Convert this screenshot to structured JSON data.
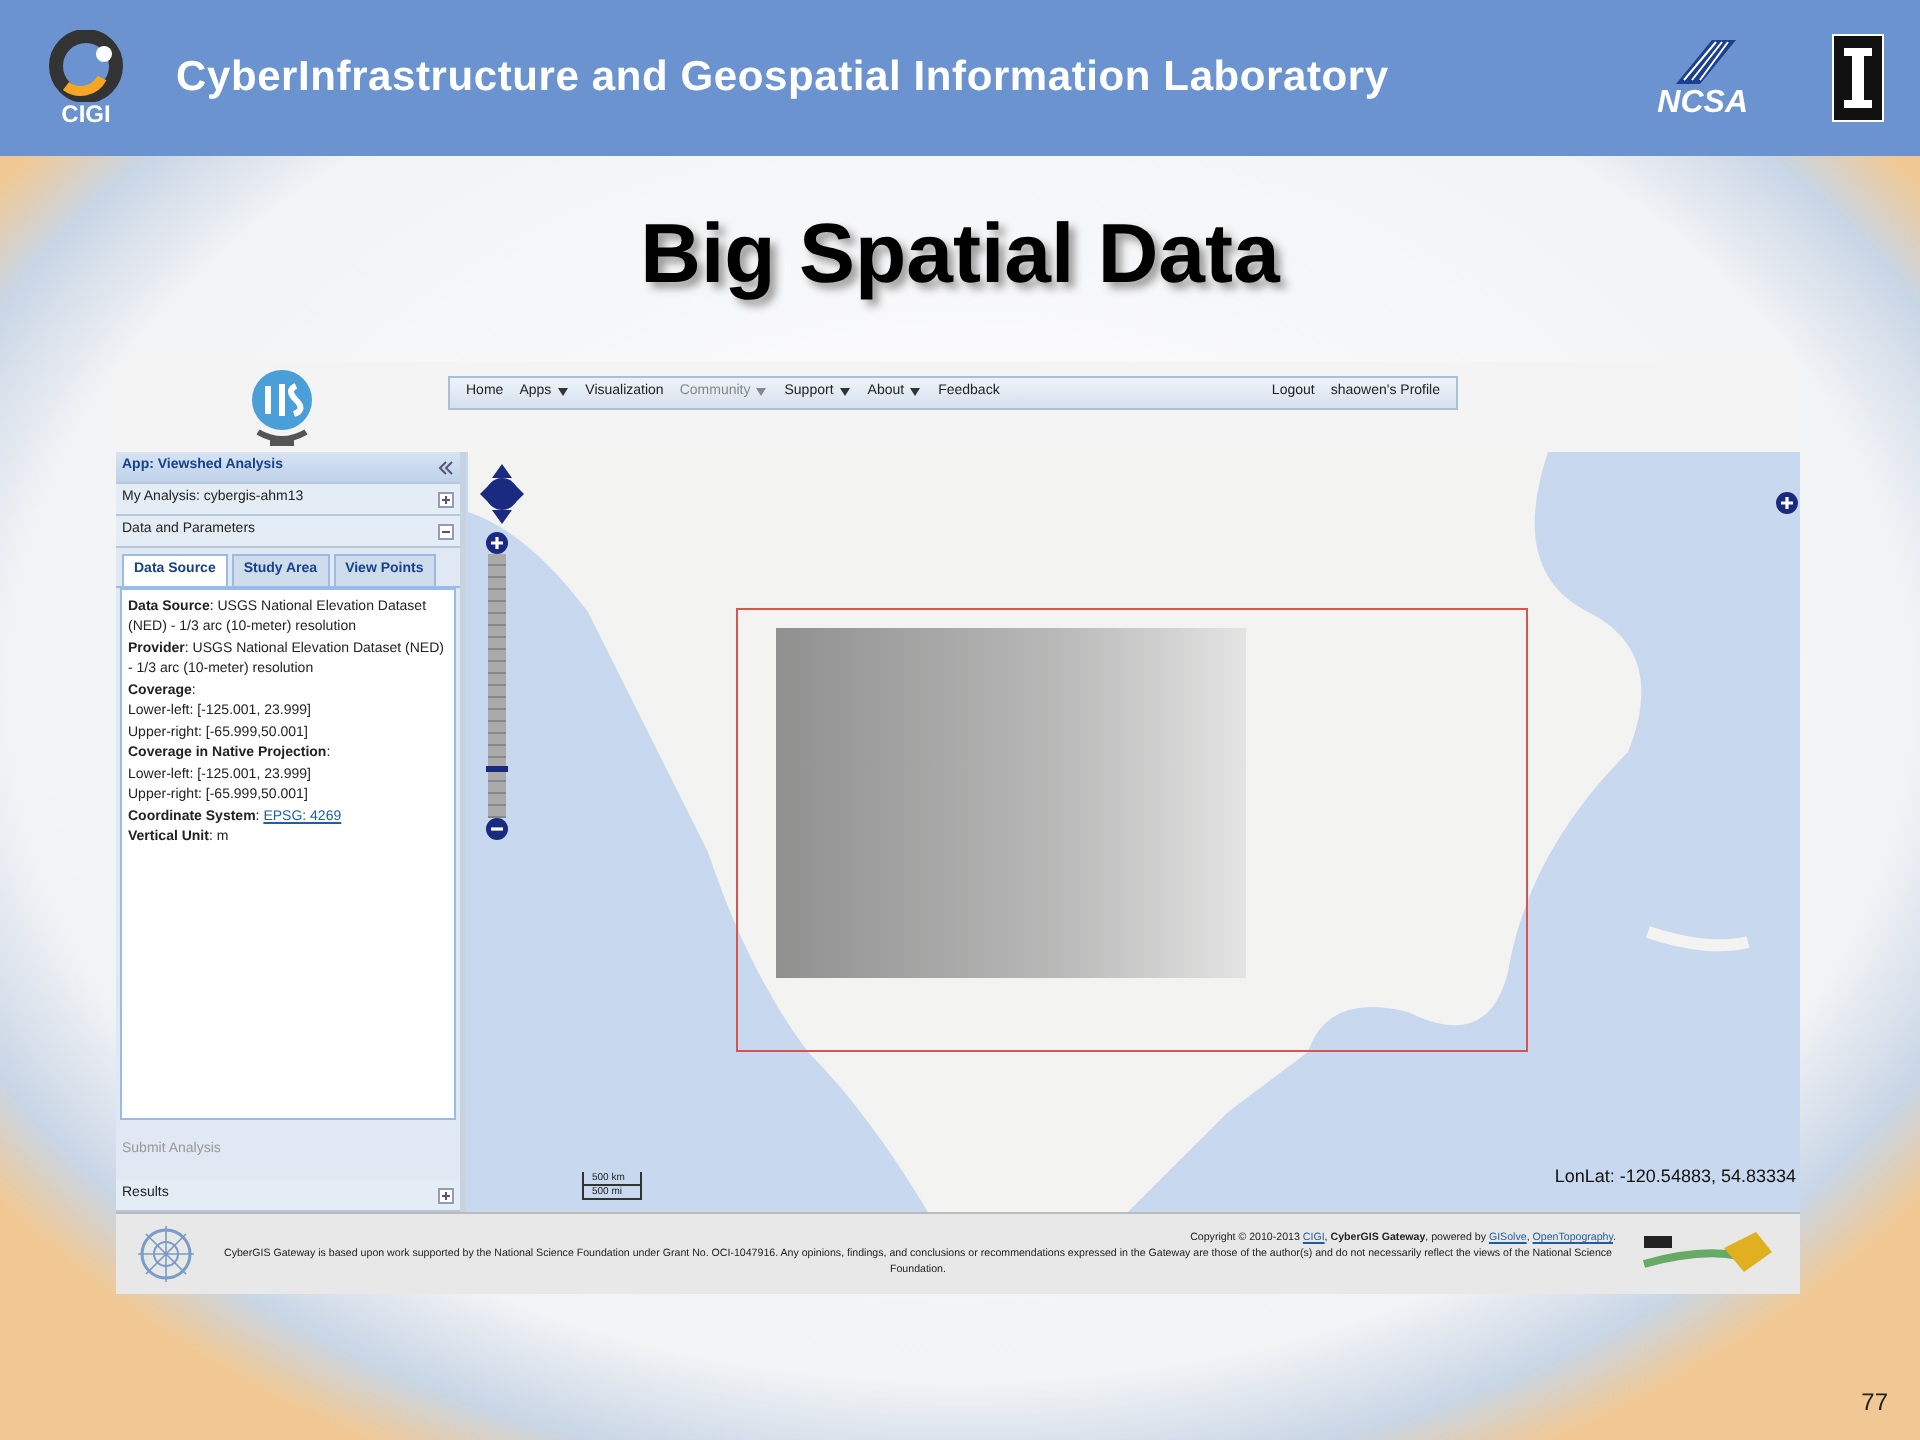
{
  "header": {
    "logo_text": "CIGI",
    "title": "CyberInfrastructure and Geospatial Information Laboratory",
    "partner_logo_text": "NCSA"
  },
  "slide_title": "Big Spatial Data",
  "gateway": {
    "nav": [
      {
        "label": "Home",
        "dropdown": false,
        "disabled": false
      },
      {
        "label": "Apps",
        "dropdown": true,
        "disabled": false
      },
      {
        "label": "Visualization",
        "dropdown": false,
        "disabled": false
      },
      {
        "label": "Community",
        "dropdown": true,
        "disabled": true
      },
      {
        "label": "Support",
        "dropdown": true,
        "disabled": false
      },
      {
        "label": "About",
        "dropdown": true,
        "disabled": false
      },
      {
        "label": "Feedback",
        "dropdown": false,
        "disabled": false
      }
    ],
    "nav_right": [
      "Logout",
      "shaowen's Profile"
    ],
    "panel": {
      "title": "App: Viewshed Analysis",
      "sections": [
        {
          "label": "My Analysis: cybergis-ahm13",
          "expanded": false
        },
        {
          "label": "Data and Parameters",
          "expanded": true
        }
      ],
      "tabs": [
        {
          "label": "Data Source",
          "selected": true
        },
        {
          "label": "Study Area",
          "selected": false
        },
        {
          "label": "View Points",
          "selected": false
        }
      ],
      "details": [
        {
          "kind": "text",
          "text": "**Data Source**: USGS National Elevation Dataset (NED) - 1/3 arc (10-meter) resolution"
        },
        {
          "kind": "text",
          "text": "**Provider**: USGS National Elevation Dataset (NED) - 1/3 arc (10-meter) resolution"
        },
        {
          "kind": "text",
          "text": "**Coverage**:"
        },
        {
          "kind": "text",
          "text": "Lower-left: [-125.001, 23.999]"
        },
        {
          "kind": "text",
          "text": "Upper-right: [-65.999,50.001]"
        },
        {
          "kind": "text",
          "text": "**Coverage in Native Projection**:"
        },
        {
          "kind": "text",
          "text": "Lower-left: [-125.001, 23.999]"
        },
        {
          "kind": "text",
          "text": "Upper-right: [-65.999,50.001]"
        },
        {
          "kind": "link",
          "text": "**Coordinate System**:",
          "link": "EPSG: 4269"
        },
        {
          "kind": "text",
          "text": "**Vertical Unit**: m"
        }
      ],
      "submit": {
        "label": "Submit Analysis",
        "disabled": true
      },
      "results": {
        "label": "Results",
        "expanded": false
      }
    },
    "map": {
      "zoom": {
        "level": 0.18
      },
      "scale": [
        "500 km",
        "500 mi"
      ],
      "lonlat": "LonLat: -120.54883, 54.83334"
    },
    "footer": {
      "copyright": [
        {
          "kind": "text",
          "text": "Copyright © 2010-2013 "
        },
        {
          "kind": "link",
          "text": "CIGI"
        },
        {
          "kind": "text",
          "text": ", **CyberGIS Gateway**, powered by "
        },
        {
          "kind": "link",
          "text": "GISolve"
        },
        {
          "kind": "text",
          "text": ", "
        },
        {
          "kind": "link",
          "text": "OpenTopography"
        },
        {
          "kind": "text",
          "text": "."
        }
      ],
      "notice": "CyberGIS Gateway is based upon work supported by the National Science Foundation under Grant No. OCI-1047916. Any opinions, findings, and conclusions or recommendations expressed in the Gateway are those of the author(s) and do not necessarily reflect the views of the National Science Foundation."
    }
  },
  "slide_number": "77"
}
